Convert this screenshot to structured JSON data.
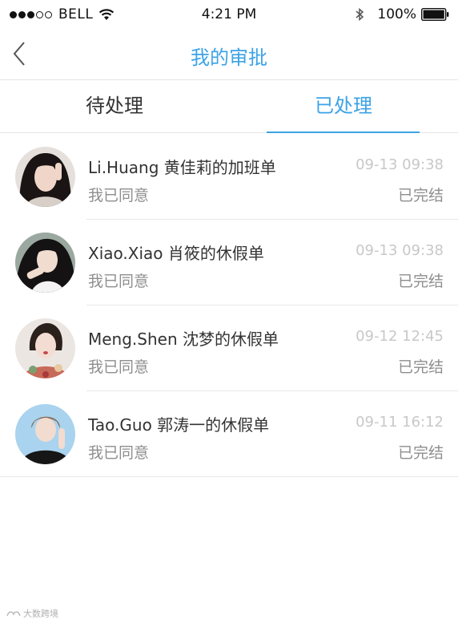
{
  "status_bar": {
    "carrier": "BELL",
    "time": "4:21 PM",
    "battery": "100%",
    "signal_full": 3,
    "signal_total": 5
  },
  "nav": {
    "title": "我的审批",
    "back_icon": "chevron-left-icon"
  },
  "tabs": [
    {
      "label": "待处理",
      "active": false
    },
    {
      "label": "已处理",
      "active": true
    }
  ],
  "approvals": [
    {
      "title": "Li.Huang 黄佳莉的加班单",
      "time": "09-13 09:38",
      "subtitle": "我已同意",
      "status": "已完结"
    },
    {
      "title": "Xiao.Xiao 肖筱的休假单",
      "time": "09-13 09:38",
      "subtitle": "我已同意",
      "status": "已完结"
    },
    {
      "title": "Meng.Shen 沈梦的休假单",
      "time": "09-12 12:45",
      "subtitle": "我已同意",
      "status": "已完结"
    },
    {
      "title": "Tao.Guo 郭涛一的休假单",
      "time": "09-11 16:12",
      "subtitle": "我已同意",
      "status": "已完结"
    }
  ],
  "watermark": "大数跨境",
  "colors": {
    "accent": "#3da3e6",
    "title_text": "#333333",
    "secondary_text": "#8e8e8e",
    "time_text": "#c8c8c8"
  }
}
